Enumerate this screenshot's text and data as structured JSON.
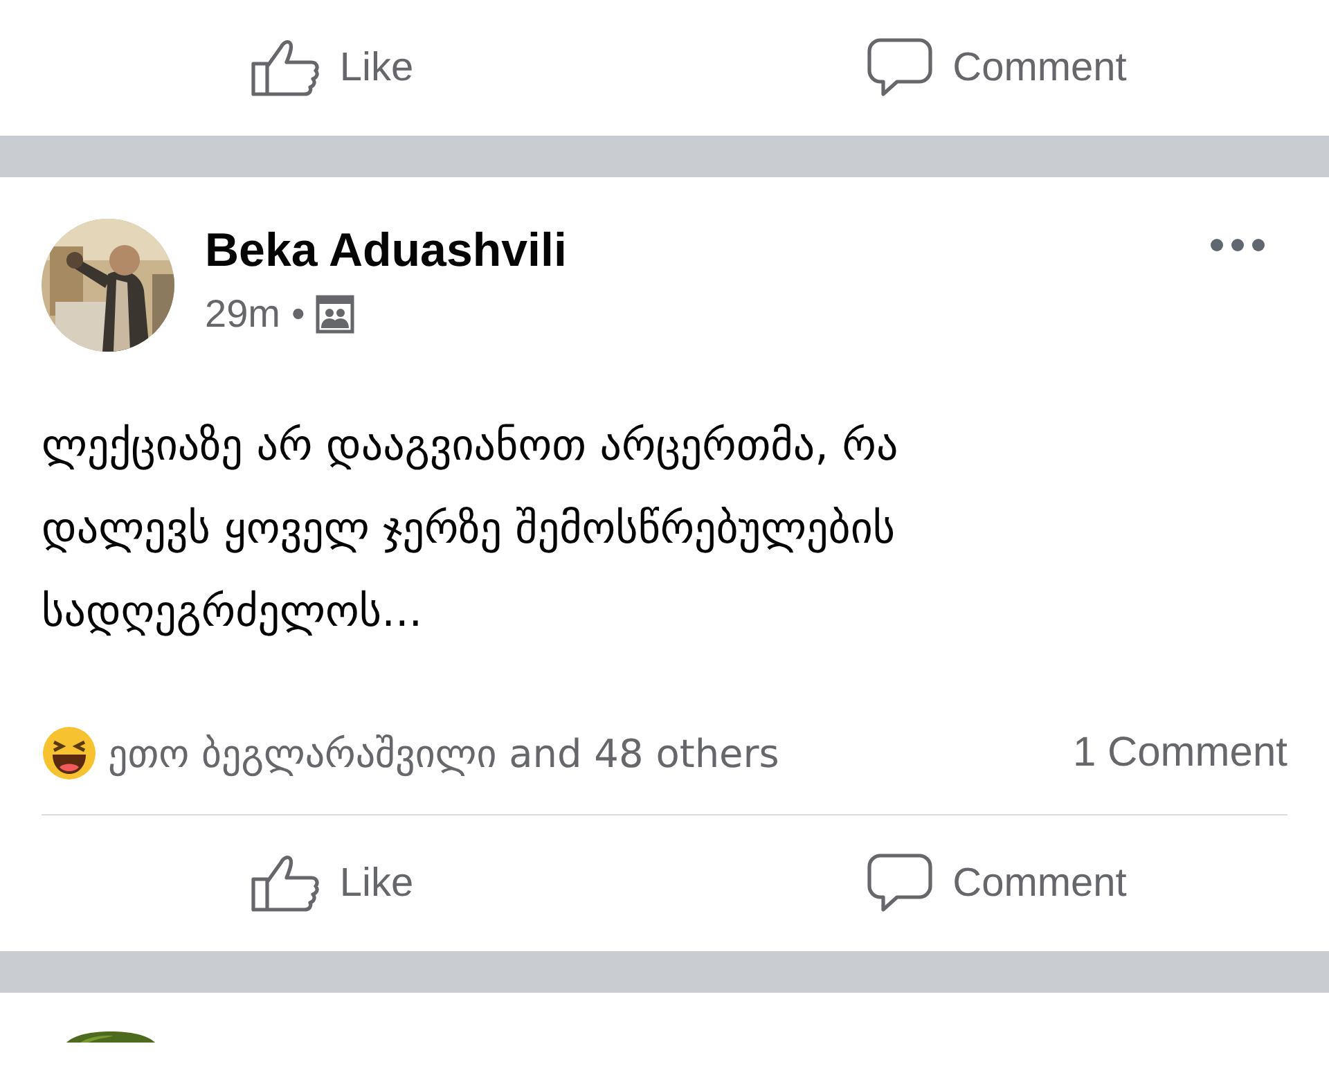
{
  "top_actions": [
    {
      "kind": "like",
      "label": "Like"
    },
    {
      "kind": "comment",
      "label": "Comment"
    }
  ],
  "post": {
    "author": "Beka Aduashvili",
    "time": "29m",
    "separator": "•",
    "text": "ლექციაზე არ დააგვიანოთ არცერთმა, რა დალევს ყოველ ჯერზე შემოსწრებულების სადღეგრძელოს...",
    "reactions": {
      "names": "ეთო ბეგლარაშვილი and 48 others",
      "comments": "1 Comment"
    },
    "actions": [
      {
        "kind": "like",
        "label": "Like"
      },
      {
        "kind": "comment",
        "label": "Comment"
      }
    ]
  }
}
